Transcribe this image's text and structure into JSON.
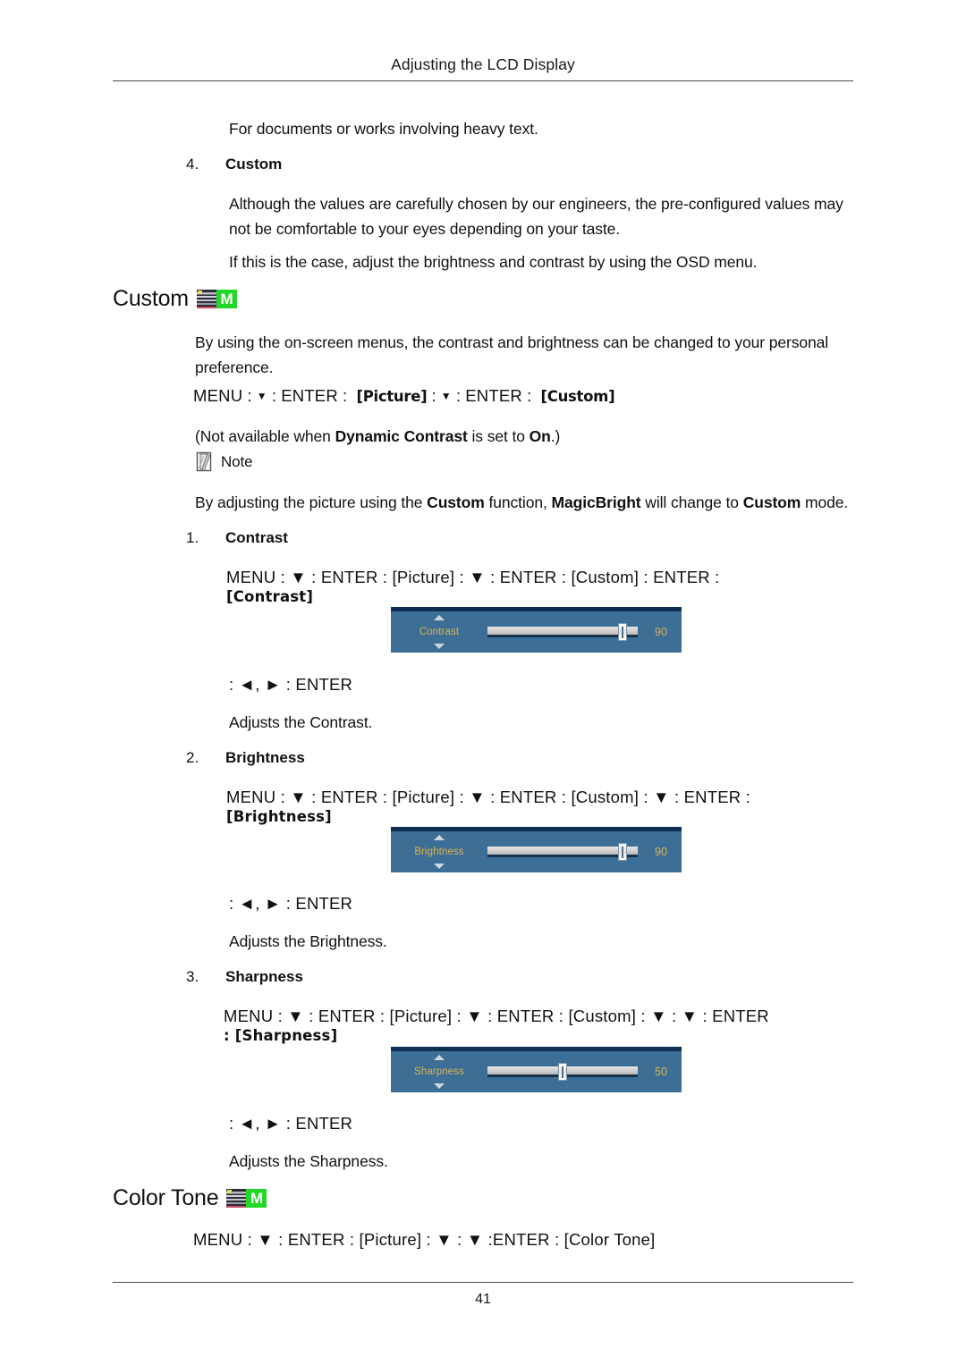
{
  "header": {
    "title": "Adjusting the LCD Display"
  },
  "footer": {
    "page_number": "41"
  },
  "intro": {
    "line1": "For documents or works involving heavy text."
  },
  "list_item_4": {
    "index": "4.",
    "label": "Custom",
    "paragraph1": "Although the values are carefully chosen by our engineers, the pre-configured values may not be comfortable to your eyes depending on your taste.",
    "paragraph2": "If this is the case, adjust the brightness and contrast by using the OSD menu."
  },
  "custom_section": {
    "heading": "Custom",
    "badge_letter": "M",
    "description": "By using the on-screen menus, the contrast and brightness can be changed to your personal preference.",
    "menu_path": {
      "menu": "MENU",
      "arrow_down": "▼",
      "enter": "ENTER",
      "token_picture": "[Picture]",
      "token_custom": "[Custom]",
      "sep": ":"
    },
    "availability_note": {
      "prefix": "(Not available when ",
      "bold1": "Dynamic Contrast",
      "middle": " is set to ",
      "bold2": "On",
      "suffix": ".)"
    },
    "note": {
      "label": "Note",
      "text_prefix": "By adjusting the picture using the ",
      "bold1": "Custom",
      "text_mid1": " function, ",
      "bold2": "MagicBright",
      "text_mid2": " will change to ",
      "bold3": "Custom",
      "text_suffix": " mode."
    }
  },
  "items": [
    {
      "index": "1.",
      "label": "Contrast",
      "path_line1": "MENU : ▼ : ENTER : [Picture] : ▼ : ENTER : [Custom] : ENTER :",
      "path_line2": "[Contrast]",
      "osd": {
        "label": "Contrast",
        "value": "90",
        "percent": 90
      },
      "adjust_line": ": ◄, ► : ENTER",
      "description": "Adjusts the Contrast."
    },
    {
      "index": "2.",
      "label": "Brightness",
      "path_line1": "MENU : ▼ : ENTER : [Picture] : ▼ : ENTER : [Custom] : ▼ : ENTER :",
      "path_line2": "[Brightness]",
      "osd": {
        "label": "Brightness",
        "value": "90",
        "percent": 90
      },
      "adjust_line": ": ◄, ► : ENTER",
      "description": "Adjusts the Brightness."
    },
    {
      "index": "3.",
      "label": "Sharpness",
      "path_line1": "MENU : ▼ : ENTER : [Picture] : ▼ : ENTER : [Custom] : ▼ : ▼ : ENTER",
      "path_line2": ": [Sharpness]",
      "osd": {
        "label": "Sharpness",
        "value": "50",
        "percent": 50
      },
      "adjust_line": ": ◄, ► : ENTER",
      "description": "Adjusts the Sharpness."
    }
  ],
  "color_tone_section": {
    "heading": "Color Tone",
    "badge_letter": "M",
    "menu_path": "MENU : ▼ : ENTER : [Picture] : ▼ : ▼ :ENTER : [Color Tone]"
  },
  "colors": {
    "osd_panel": "#3d6e96",
    "osd_top_band": "#0e2f52",
    "osd_text": "#d8b34c",
    "badge_green": "#22d726",
    "rule": "#4a4a4a"
  }
}
